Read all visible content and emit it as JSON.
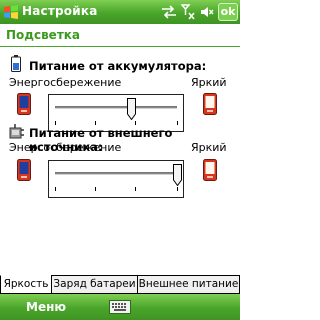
{
  "titlebar": {
    "app_title": "Настройка",
    "ok_label": "ok",
    "icons": [
      "windows-flag-icon",
      "sync-arrows-icon",
      "signal-off-icon",
      "volume-muted-icon"
    ]
  },
  "page": {
    "title": "Подсветка"
  },
  "battery": {
    "title": "Питание от аккумулятора:",
    "low_label": "Энергосбережение",
    "high_label": "Яркий",
    "level_fraction": 0.63
  },
  "external": {
    "title": "Питание от внешнего источника:",
    "low_label": "Энергосбережение",
    "high_label": "Яркий",
    "level_fraction": 1.0
  },
  "tabs": [
    {
      "label": "Яркость",
      "active": true
    },
    {
      "label": "Заряд батареи",
      "active": false
    },
    {
      "label": "Внешнее питание",
      "active": false
    }
  ],
  "menubar": {
    "menu_label": "Меню"
  },
  "colors": {
    "accent_green": "#4aa52c",
    "title_green": "#3a9a1e"
  }
}
